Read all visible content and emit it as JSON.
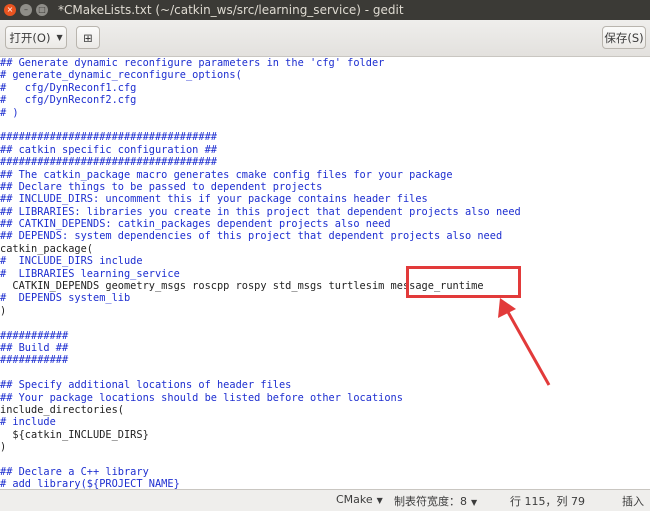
{
  "window": {
    "title": "*CMakeLists.txt (~/catkin_ws/src/learning_service) - gedit",
    "close_glyph": "×",
    "minimize_glyph": "–",
    "maximize_glyph": "□"
  },
  "toolbar": {
    "open_label": "打开(O)",
    "open_dropdown_glyph": "▼",
    "new_tab_glyph": "⊞",
    "save_label": "保存(S)"
  },
  "editor": {
    "lines": [
      "## Generate dynamic reconfigure parameters in the 'cfg' folder",
      "# generate_dynamic_reconfigure_options(",
      "#   cfg/DynReconf1.cfg",
      "#   cfg/DynReconf2.cfg",
      "# )",
      "",
      "###################################",
      "## catkin specific configuration ##",
      "###################################",
      "## The catkin_package macro generates cmake config files for your package",
      "## Declare things to be passed to dependent projects",
      "## INCLUDE_DIRS: uncomment this if your package contains header files",
      "## LIBRARIES: libraries you create in this project that dependent projects also need",
      "## CATKIN_DEPENDS: catkin_packages dependent projects also need",
      "## DEPENDS: system dependencies of this project that dependent projects also need",
      "catkin_package(",
      "#  INCLUDE_DIRS include",
      "#  LIBRARIES learning_service",
      "  CATKIN_DEPENDS geometry_msgs roscpp rospy std_msgs turtlesim message_runtime",
      "#  DEPENDS system_lib",
      ")",
      "",
      "###########",
      "## Build ##",
      "###########",
      "",
      "## Specify additional locations of header files",
      "## Your package locations should be listed before other locations",
      "include_directories(",
      "# include",
      "  ${catkin_INCLUDE_DIRS}",
      ")",
      "",
      "## Declare a C++ library",
      "# add_library(${PROJECT_NAME}"
    ]
  },
  "statusbar": {
    "language": "CMake",
    "tab_width": "制表符宽度：8",
    "position": "行 115，列 79",
    "insert_mode": "插入",
    "dropdown_glyph": "▼"
  },
  "colors": {
    "comment": "#1e2fd0",
    "highlight_box": "#e23a3a",
    "titlebar": "#3b3a36",
    "close_button": "#e95420"
  }
}
